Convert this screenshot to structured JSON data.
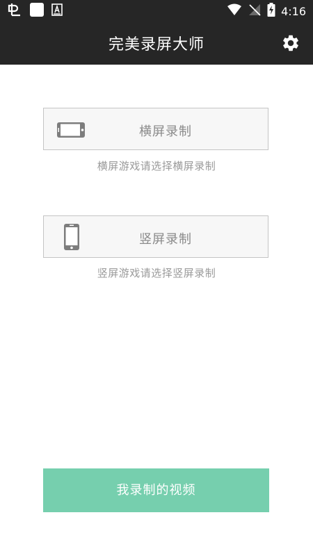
{
  "status_bar": {
    "time": "4:16",
    "left_icons": [
      "app-notification-icon",
      "square-notification-icon",
      "a-notification-icon"
    ],
    "right_icons": [
      "wifi-icon",
      "no-signal-icon",
      "battery-charging-icon"
    ]
  },
  "app_bar": {
    "title": "完美录屏大师",
    "settings_icon": "gear-icon"
  },
  "options": [
    {
      "label": "横屏录制",
      "hint": "横屏游戏请选择横屏录制",
      "icon": "landscape-phone-icon"
    },
    {
      "label": "竖屏录制",
      "hint": "竖屏游戏请选择竖屏录制",
      "icon": "portrait-phone-icon"
    }
  ],
  "my_videos_button": {
    "label": "我录制的视频"
  },
  "colors": {
    "bar_background": "#262626",
    "accent_button": "#76cfae",
    "option_border": "#c4c4c4",
    "option_background": "#f7f7f7",
    "text_gray": "#8a8a8a"
  }
}
